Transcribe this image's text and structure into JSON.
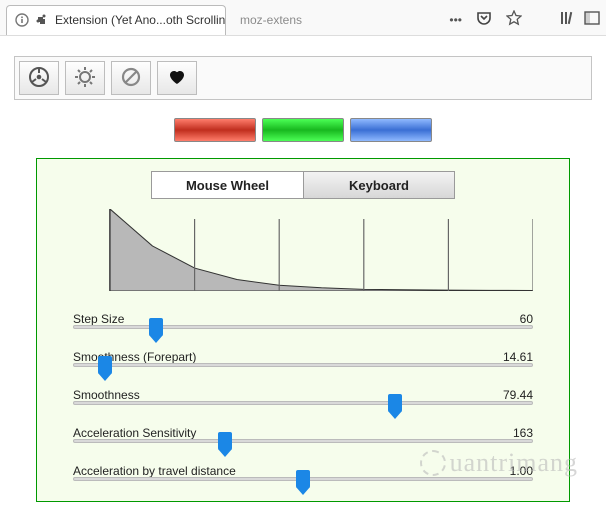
{
  "browser": {
    "tab_title": "Extension (Yet Ano...oth Scrolling WE)",
    "url_text": "moz-extens"
  },
  "color_buttons": [
    "red",
    "green",
    "blue"
  ],
  "tabs": {
    "mouse_wheel": "Mouse Wheel",
    "keyboard": "Keyboard",
    "active": "keyboard"
  },
  "sliders": [
    {
      "label": "Step Size",
      "value": "60",
      "pos": 18
    },
    {
      "label": "Smoothness (Forepart)",
      "value": "14.61",
      "pos": 7
    },
    {
      "label": "Smoothness",
      "value": "79.44",
      "pos": 70
    },
    {
      "label": "Acceleration Sensitivity",
      "value": "163",
      "pos": 33
    },
    {
      "label": "Acceleration by travel distance",
      "value": "1.00",
      "pos": 50
    }
  ],
  "chart_data": {
    "type": "area",
    "x": [
      0,
      0.1,
      0.2,
      0.3,
      0.4,
      0.5,
      0.6,
      0.7,
      0.8,
      0.9,
      1.0
    ],
    "y": [
      1.0,
      0.55,
      0.28,
      0.14,
      0.07,
      0.04,
      0.02,
      0.015,
      0.01,
      0.008,
      0.006
    ],
    "title": "",
    "xlabel": "",
    "ylabel": "",
    "xlim": [
      0,
      1
    ],
    "ylim": [
      0,
      1
    ],
    "vertical_markers": [
      0.2,
      0.4,
      0.6,
      0.8,
      1.0
    ]
  },
  "watermark": "uantrimang"
}
